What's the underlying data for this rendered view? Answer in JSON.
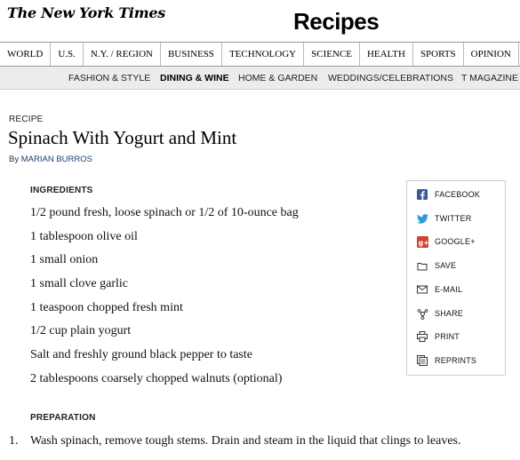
{
  "header": {
    "logo": "The New York Times",
    "section_title": "Recipes"
  },
  "topnav": {
    "items": [
      "WORLD",
      "U.S.",
      "N.Y. / REGION",
      "BUSINESS",
      "TECHNOLOGY",
      "SCIENCE",
      "HEALTH",
      "SPORTS",
      "OPINION"
    ]
  },
  "subnav": {
    "items": [
      "FASHION & STYLE",
      "DINING & WINE",
      "HOME & GARDEN",
      "WEDDINGS/CELEBRATIONS",
      "T MAGAZINE"
    ],
    "active": "DINING & WINE"
  },
  "article": {
    "kicker": "RECIPE",
    "headline": "Spinach With Yogurt and Mint",
    "byline_prefix": "By",
    "author": "MARIAN BURROS",
    "ingredients_header": "INGREDIENTS",
    "ingredients": [
      "1/2 pound fresh, loose spinach or 1/2 of 10-ounce bag",
      "1 tablespoon olive oil",
      "1 small onion",
      "1 small clove garlic",
      "1 teaspoon chopped fresh mint",
      "1/2 cup plain yogurt",
      "Salt and freshly ground black pepper to taste",
      "2 tablespoons coarsely chopped walnuts (optional)"
    ],
    "preparation_header": "PREPARATION",
    "steps": [
      {
        "num": "1.",
        "text": "Wash spinach, remove tough stems. Drain and steam in the liquid that clings to leaves."
      }
    ]
  },
  "share": {
    "items": [
      {
        "label": "FACEBOOK",
        "icon": "facebook-icon",
        "color": "#3b5998"
      },
      {
        "label": "TWITTER",
        "icon": "twitter-icon",
        "color": "#2b9be0"
      },
      {
        "label": "GOOGLE+",
        "icon": "google-plus-icon",
        "color": "#d23f31"
      },
      {
        "label": "SAVE",
        "icon": "save-icon",
        "color": "#333333"
      },
      {
        "label": "E-MAIL",
        "icon": "email-icon",
        "color": "#333333"
      },
      {
        "label": "SHARE",
        "icon": "share-icon",
        "color": "#333333"
      },
      {
        "label": "PRINT",
        "icon": "print-icon",
        "color": "#333333"
      },
      {
        "label": "REPRINTS",
        "icon": "reprints-icon",
        "color": "#333333"
      }
    ]
  }
}
